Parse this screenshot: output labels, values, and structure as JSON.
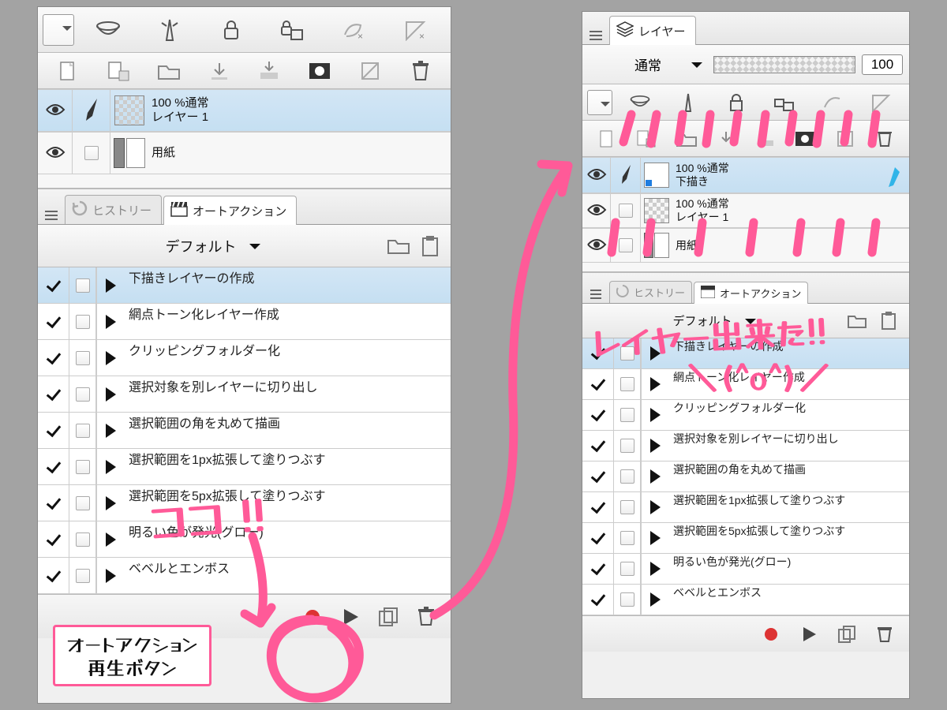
{
  "left": {
    "layers": [
      {
        "opacity": "100 %通常",
        "name": "レイヤー 1",
        "selected": true,
        "hasBrush": true,
        "thumb": "checker"
      },
      {
        "opacity": "",
        "name": "用紙",
        "selected": false,
        "hasBrush": false,
        "thumb": "white"
      }
    ],
    "tabs": {
      "history": "ヒストリー",
      "autoaction": "オートアクション"
    },
    "actionSet": "デフォルト",
    "actions": [
      "下描きレイヤーの作成",
      "網点トーン化レイヤー作成",
      "クリッピングフォルダー化",
      "選択対象を別レイヤーに切り出し",
      "選択範囲の角を丸めて描画",
      "選択範囲を1px拡張して塗りつぶす",
      "選択範囲を5px拡張して塗りつぶす",
      "明るい色が発光(グロー)",
      "ベベルとエンボス"
    ],
    "selectedAction": 0
  },
  "right": {
    "tabLabel": "レイヤー",
    "blendMode": "通常",
    "opacity": "100",
    "layers": [
      {
        "opacity": "100 %通常",
        "name": "下描き",
        "selected": true,
        "thumb": "white",
        "draft": true
      },
      {
        "opacity": "100 %通常",
        "name": "レイヤー 1",
        "selected": false,
        "thumb": "checker"
      },
      {
        "opacity": "",
        "name": "用紙",
        "selected": false,
        "thumb": "white"
      }
    ],
    "tabs": {
      "history": "ヒストリー",
      "autoaction": "オートアクション"
    },
    "actionSet": "デフォルト",
    "actions": [
      "下描きレイヤーの作成",
      "網点トーン化レイヤー作成",
      "クリッピングフォルダー化",
      "選択対象を別レイヤーに切り出し",
      "選択範囲の角を丸めて描画",
      "選択範囲を1px拡張して塗りつぶす",
      "選択範囲を5px拡張して塗りつぶす",
      "明るい色が発光(グロー)",
      "ベベルとエンボス"
    ],
    "selectedAction": 0
  },
  "annotations": {
    "koko": "ココ !!",
    "playbtn_line1": "オートアクション",
    "playbtn_line2": "再生ボタン",
    "layer_done": "レイヤー出来た!!",
    "face": "＼(^o^)／"
  }
}
